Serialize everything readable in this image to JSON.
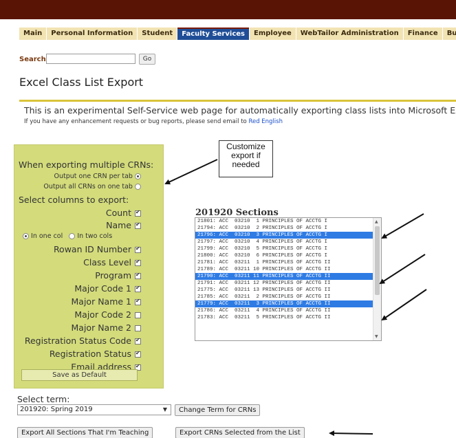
{
  "nav": {
    "tabs": [
      {
        "label": "Main",
        "active": false
      },
      {
        "label": "Personal Information",
        "active": false
      },
      {
        "label": "Student",
        "active": false
      },
      {
        "label": "Faculty Services",
        "active": true
      },
      {
        "label": "Employee",
        "active": false
      },
      {
        "label": "WebTailor Administration",
        "active": false
      },
      {
        "label": "Finance",
        "active": false
      },
      {
        "label": "Bursar",
        "active": false
      }
    ]
  },
  "search": {
    "label": "Search",
    "value": "",
    "go_label": "Go"
  },
  "page_title": "Excel Class List Export",
  "intro": {
    "text": "This is an experimental Self-Service web page for automatically exporting class lists into Microsoft Ex",
    "note_prefix": "If you have any enhancement requests or bug reports, please send email to ",
    "note_link": "Red English"
  },
  "options": {
    "multiple_heading": "When exporting multiple CRNs:",
    "one_per_tab": "Output one CRN per tab",
    "all_on_one_tab": "Output all CRNs on one tab",
    "columns_heading": "Select columns to export:",
    "name_one_col": "In one col",
    "name_two_cols": "In two cols",
    "columns": [
      {
        "label": "Count",
        "checked": true
      },
      {
        "label": "Name",
        "checked": true
      },
      {
        "label": "Rowan ID Number",
        "checked": true
      },
      {
        "label": "Class Level",
        "checked": true
      },
      {
        "label": "Program",
        "checked": true
      },
      {
        "label": "Major Code 1",
        "checked": true
      },
      {
        "label": "Major Name 1",
        "checked": true
      },
      {
        "label": "Major Code 2",
        "checked": false
      },
      {
        "label": "Major Name 2",
        "checked": false
      },
      {
        "label": "Registration Status Code",
        "checked": true
      },
      {
        "label": "Registration Status",
        "checked": true
      },
      {
        "label": "Email address",
        "checked": true
      }
    ],
    "save_default_label": "Save as Default"
  },
  "callout": {
    "line1": "Customize",
    "line2": "export if",
    "line3": "needed"
  },
  "sections": {
    "title": "201920 Sections",
    "rows": [
      {
        "text": "21801: ACC  03210  1 PRINCIPLES OF ACCTG I",
        "selected": false
      },
      {
        "text": "21794: ACC  03210  2 PRINCIPLES OF ACCTG I",
        "selected": false
      },
      {
        "text": "21796: ACC  03210  3 PRINCIPLES OF ACCTG I",
        "selected": true
      },
      {
        "text": "21797: ACC  03210  4 PRINCIPLES OF ACCTG I",
        "selected": false
      },
      {
        "text": "21799: ACC  03210  5 PRINCIPLES OF ACCTG I",
        "selected": false
      },
      {
        "text": "21800: ACC  03210  6 PRINCIPLES OF ACCTG I",
        "selected": false
      },
      {
        "text": "21781: ACC  03211  1 PRINCIPLES OF ACCTG II",
        "selected": false
      },
      {
        "text": "21789: ACC  03211 10 PRINCIPLES OF ACCTG II",
        "selected": false
      },
      {
        "text": "21790: ACC  03211 11 PRINCIPLES OF ACCTG II",
        "selected": true
      },
      {
        "text": "21791: ACC  03211 12 PRINCIPLES OF ACCTG II",
        "selected": false
      },
      {
        "text": "21775: ACC  03211 13 PRINCIPLES OF ACCTG II",
        "selected": false
      },
      {
        "text": "21785: ACC  03211  2 PRINCIPLES OF ACCTG II",
        "selected": false
      },
      {
        "text": "21779: ACC  03211  3 PRINCIPLES OF ACCTG II",
        "selected": true
      },
      {
        "text": "21786: ACC  03211  4 PRINCIPLES OF ACCTG II",
        "selected": false
      },
      {
        "text": "21783: ACC  03211  5 PRINCIPLES OF ACCTG II",
        "selected": false
      }
    ]
  },
  "term": {
    "label": "Select term:",
    "selected": "201920: Spring 2019",
    "change_label": "Change Term for CRNs"
  },
  "actions": {
    "export_all_label": "Export All Sections That I'm Teaching",
    "export_selected_label": "Export CRNs Selected from the List"
  },
  "colors": {
    "top_bar": "#5a1406",
    "active_tab": "#1f4e97",
    "tab_bg": "#f2e3b3",
    "panel_bg": "#d3db7b",
    "selection": "#2e7be4",
    "rule": "#d9c43a",
    "link": "#1a4ec8"
  }
}
